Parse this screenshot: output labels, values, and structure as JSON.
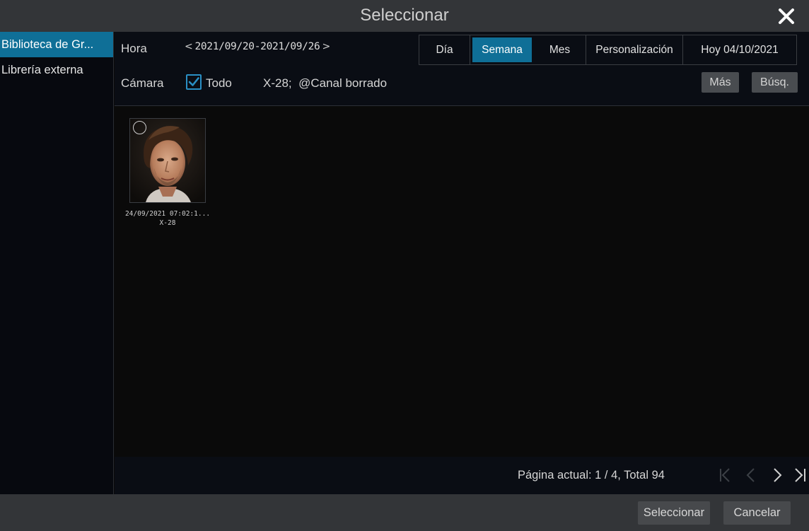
{
  "window": {
    "title": "Seleccionar"
  },
  "sidebar": {
    "items": [
      {
        "label": "Biblioteca de Gr..."
      },
      {
        "label": "Librería externa"
      }
    ]
  },
  "filters": {
    "time_label": "Hora",
    "range": "2021/09/20-2021/09/26",
    "periods": [
      "Día",
      "Semana",
      "Mes",
      "Personalización"
    ],
    "active_period": "Semana",
    "today": "Hoy 04/10/2021",
    "camera_label": "Cámara",
    "all_label": "Todo",
    "all_checked": true,
    "channels": "X-28;  @Canal borrado",
    "more": "Más",
    "search": "Búsq."
  },
  "results": [
    {
      "datetime": "24/09/2021 07:02:1...",
      "camera": "X-28"
    }
  ],
  "pagination": {
    "info": "Página actual: 1 / 4, Total 94"
  },
  "footer": {
    "select": "Seleccionar",
    "cancel": "Cancelar"
  },
  "colors": {
    "accent": "#0f6f97",
    "checkbox": "#2a8fc4"
  }
}
